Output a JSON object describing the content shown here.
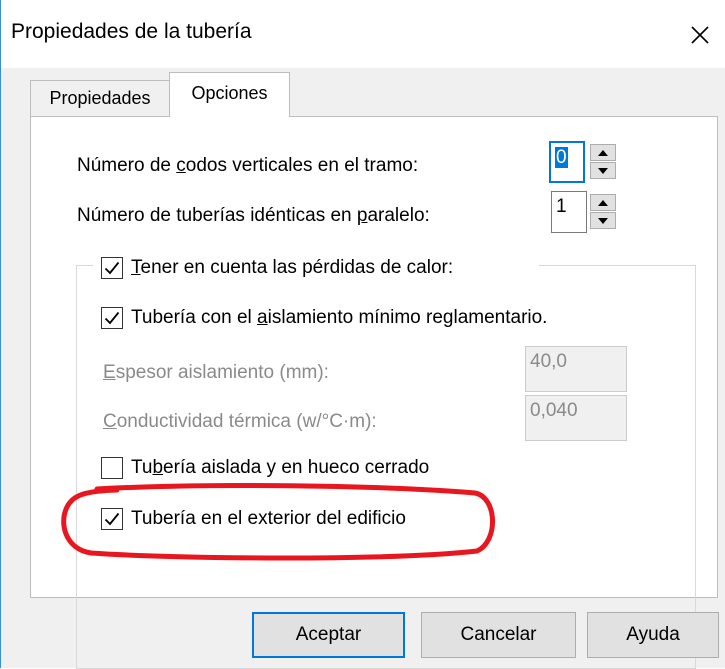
{
  "window": {
    "title": "Propiedades de la tubería"
  },
  "tabs": [
    {
      "label": "Propiedades"
    },
    {
      "label": "Opciones"
    }
  ],
  "fields": {
    "vertical_elbows": {
      "label_before": "Número de ",
      "label_key": "c",
      "label_after": "odos verticales en el tramo:",
      "value": "0"
    },
    "parallel_pipes": {
      "label_before": "Número de tuberías idénticas en ",
      "label_key": "p",
      "label_after": "aralelo:",
      "value": "1"
    }
  },
  "group": {
    "heat_losses": {
      "key": "T",
      "label": "ener en cuenta las pérdidas de calor:",
      "checked": true
    },
    "min_insulation": {
      "label_before": "Tubería con el ",
      "label_key": "a",
      "label_after": "islamiento mínimo reglamentario.",
      "checked": true
    },
    "insulation_thickness": {
      "key": "E",
      "label": "spesor aislamiento (mm):",
      "value": "40,0"
    },
    "thermal_conductivity": {
      "key": "C",
      "label": "onductividad térmica (w/°C·m):",
      "value": "0,040"
    },
    "insulated_closed": {
      "label_before": "Tu",
      "label_key": "b",
      "label_after": "ería aislada y en hueco cerrado",
      "checked": false
    },
    "exterior": {
      "label": "Tubería en el exterior del edificio",
      "checked": true
    }
  },
  "buttons": {
    "accept": "Aceptar",
    "cancel": "Cancelar",
    "help": "Ayuda"
  },
  "colors": {
    "accent": "#0078d7",
    "annotation": "#e8171f"
  }
}
